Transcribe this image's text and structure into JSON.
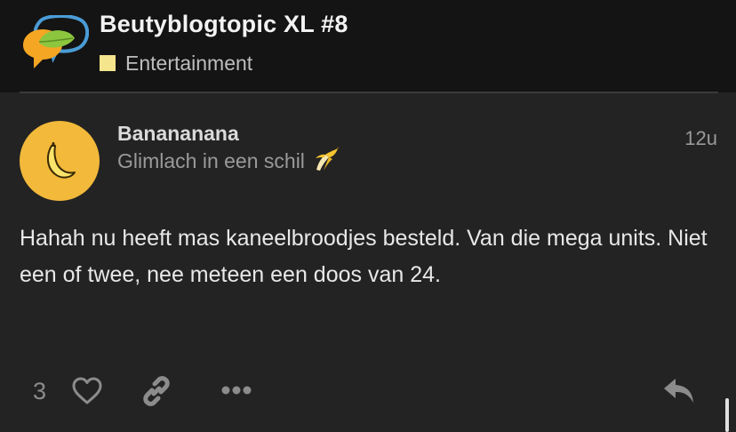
{
  "topic": {
    "title": "Beutyblogtopic XL #8",
    "category": {
      "label": "Entertainment",
      "color": "#f5e58d"
    }
  },
  "site_logo": {
    "icon": "speech-bubbles-logo-icon",
    "colors": [
      "#4a9cd6",
      "#8cc63f",
      "#f5a623"
    ]
  },
  "post": {
    "username": "Banananana",
    "user_title": "Glimlach in een schil",
    "user_title_emoji": "banana-icon",
    "age": "12u",
    "avatar": {
      "icon": "banana-icon",
      "background": "#f2b93a"
    },
    "body": "Hahah nu heeft mas kaneelbroodjes besteld. Van die mega units. Niet een of twee, nee meteen een doos van 24.",
    "like_count": "3",
    "actions": [
      "heart-icon",
      "link-icon",
      "more-icon",
      "reply-icon"
    ]
  }
}
